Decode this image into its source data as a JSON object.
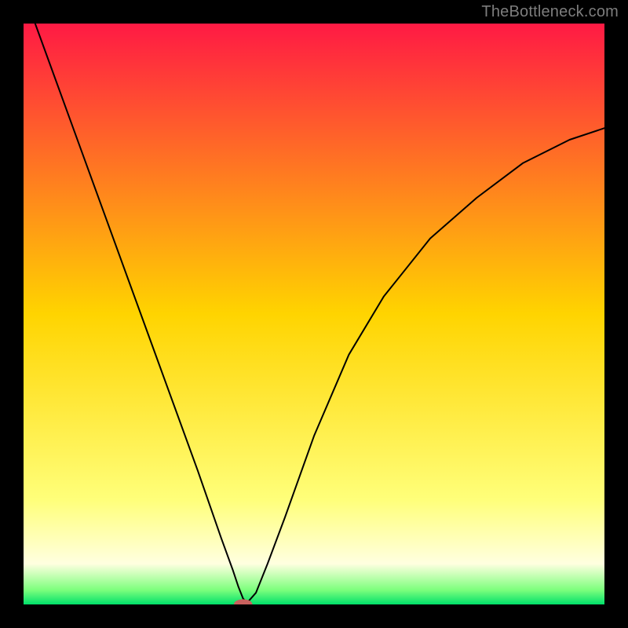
{
  "watermark": "TheBottleneck.com",
  "chart_data": {
    "type": "line",
    "title": "",
    "xlabel": "",
    "ylabel": "",
    "xlim": [
      0,
      100
    ],
    "ylim": [
      0,
      100
    ],
    "background_gradient": {
      "stops": [
        {
          "offset": 0.0,
          "color": "#ff1a44"
        },
        {
          "offset": 0.5,
          "color": "#ffd400"
        },
        {
          "offset": 0.82,
          "color": "#ffff7a"
        },
        {
          "offset": 0.93,
          "color": "#ffffe0"
        },
        {
          "offset": 0.975,
          "color": "#7dff7d"
        },
        {
          "offset": 1.0,
          "color": "#00e06a"
        }
      ]
    },
    "series": [
      {
        "name": "bottleneck-curve",
        "color": "#000000",
        "x": [
          2.0,
          6.0,
          10.0,
          14.0,
          18.0,
          22.0,
          26.0,
          30.0,
          34.0,
          36.0,
          37.0,
          37.8,
          38.5,
          40.0,
          42.0,
          45.0,
          50.0,
          56.0,
          62.0,
          70.0,
          78.0,
          86.0,
          94.0,
          100.0
        ],
        "y": [
          100.0,
          89.0,
          78.0,
          67.0,
          56.0,
          45.0,
          34.0,
          23.0,
          11.5,
          6.0,
          3.0,
          1.0,
          0.3,
          2.0,
          7.0,
          15.0,
          29.0,
          43.0,
          53.0,
          63.0,
          70.0,
          76.0,
          80.0,
          82.0
        ]
      }
    ],
    "marker": {
      "name": "optimum-marker",
      "x": 37.8,
      "y": 0.0,
      "color": "#c9615e",
      "rx": 1.6,
      "ry": 0.9
    }
  }
}
